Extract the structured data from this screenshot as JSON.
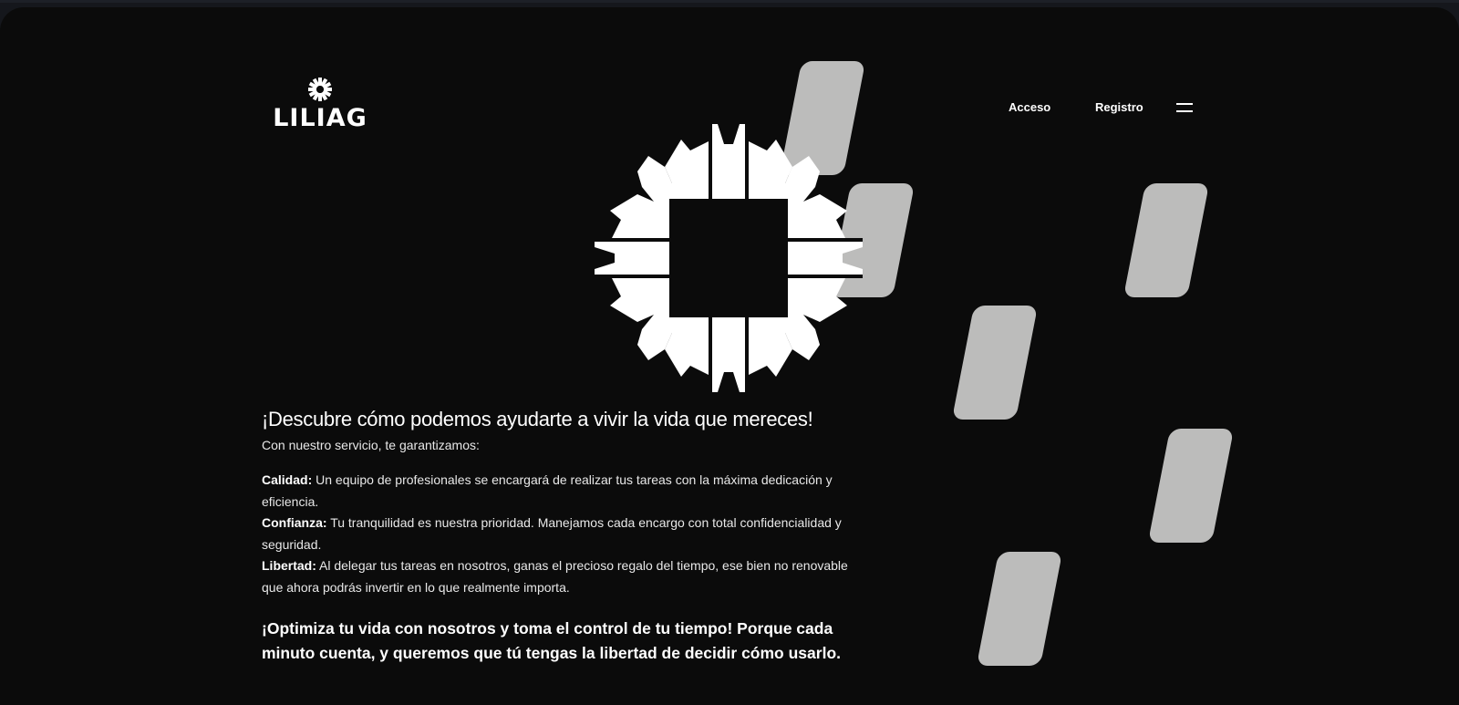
{
  "brand": {
    "name": "LILIAG"
  },
  "nav": {
    "login": "Acceso",
    "register": "Registro",
    "menu_icon": "hamburger-icon"
  },
  "hero": {
    "headline": "¡Descubre cómo podemos ayudarte a vivir la vida que mereces!",
    "intro": "Con nuestro servicio, te garantizamos:",
    "benefits": [
      {
        "term": "Calidad:",
        "text": " Un equipo de profesionales se encargará de realizar tus tareas con la máxima dedicación y eficiencia."
      },
      {
        "term": "Confianza:",
        "text": " Tu tranquilidad es nuestra prioridad. Manejamos cada encargo con total confidencialidad y seguridad."
      },
      {
        "term": "Libertad:",
        "text": " Al delegar tus tareas en nosotros, ganas el precioso regalo del tiempo, ese bien no renovable que ahora podrás invertir en lo que realmente importa."
      }
    ],
    "cta": "¡Optimiza tu vida con nosotros y toma el control de tu tiempo! Porque cada minuto cuenta, y queremos que tú tengas la libertad de decidir cómo usarlo."
  },
  "colors": {
    "background": "#0b0b0b",
    "text": "#ffffff",
    "tile": "#bcbcbb"
  }
}
